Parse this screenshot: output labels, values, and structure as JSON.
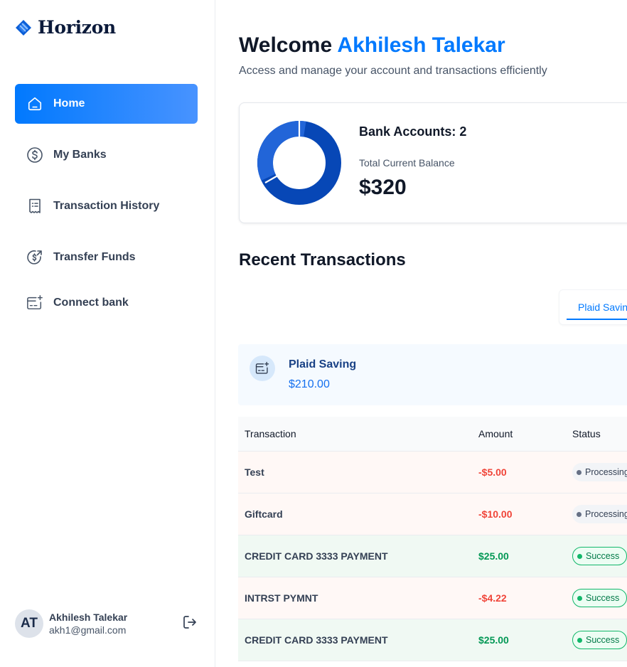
{
  "app": {
    "name": "Horizon"
  },
  "sidebar": {
    "items": [
      {
        "label": "Home",
        "icon": "home-icon",
        "active": true
      },
      {
        "label": "My Banks",
        "icon": "dollar-circle-icon",
        "active": false
      },
      {
        "label": "Transaction History",
        "icon": "receipt-icon",
        "active": false
      },
      {
        "label": "Transfer Funds",
        "icon": "money-send-icon",
        "active": false
      },
      {
        "label": "Connect bank",
        "icon": "card-add-icon",
        "active": false
      }
    ]
  },
  "user": {
    "initials": "AT",
    "name": "Akhilesh Talekar",
    "email": "akh1@gmail.com"
  },
  "header": {
    "welcome_prefix": "Welcome",
    "welcome_name": "Akhilesh Talekar",
    "subtitle": "Access and manage your account and transactions efficiently"
  },
  "balance": {
    "bank_accounts_text": "Bank Accounts: 2",
    "label": "Total Current Balance",
    "value": "$320",
    "donut_colors": [
      "#0747b6",
      "#2265d8"
    ]
  },
  "recent": {
    "title": "Recent Transactions",
    "tab_label": "Plaid Saving",
    "account": {
      "name": "Plaid Saving",
      "balance": "$210.00"
    },
    "columns": [
      "Transaction",
      "Amount",
      "Status"
    ],
    "rows": [
      {
        "name": "Test",
        "amount": "-$5.00",
        "type": "debit",
        "status": "Processing"
      },
      {
        "name": "Giftcard",
        "amount": "-$10.00",
        "type": "debit",
        "status": "Processing"
      },
      {
        "name": "CREDIT CARD 3333 PAYMENT",
        "amount": "$25.00",
        "type": "credit",
        "status": "Success"
      },
      {
        "name": "INTRST PYMNT",
        "amount": "-$4.22",
        "type": "debit",
        "status": "Success"
      },
      {
        "name": "CREDIT CARD 3333 PAYMENT",
        "amount": "$25.00",
        "type": "credit",
        "status": "Success"
      }
    ]
  },
  "colors": {
    "accent": "#0179fe",
    "debit": "#f04438",
    "credit": "#039855"
  }
}
